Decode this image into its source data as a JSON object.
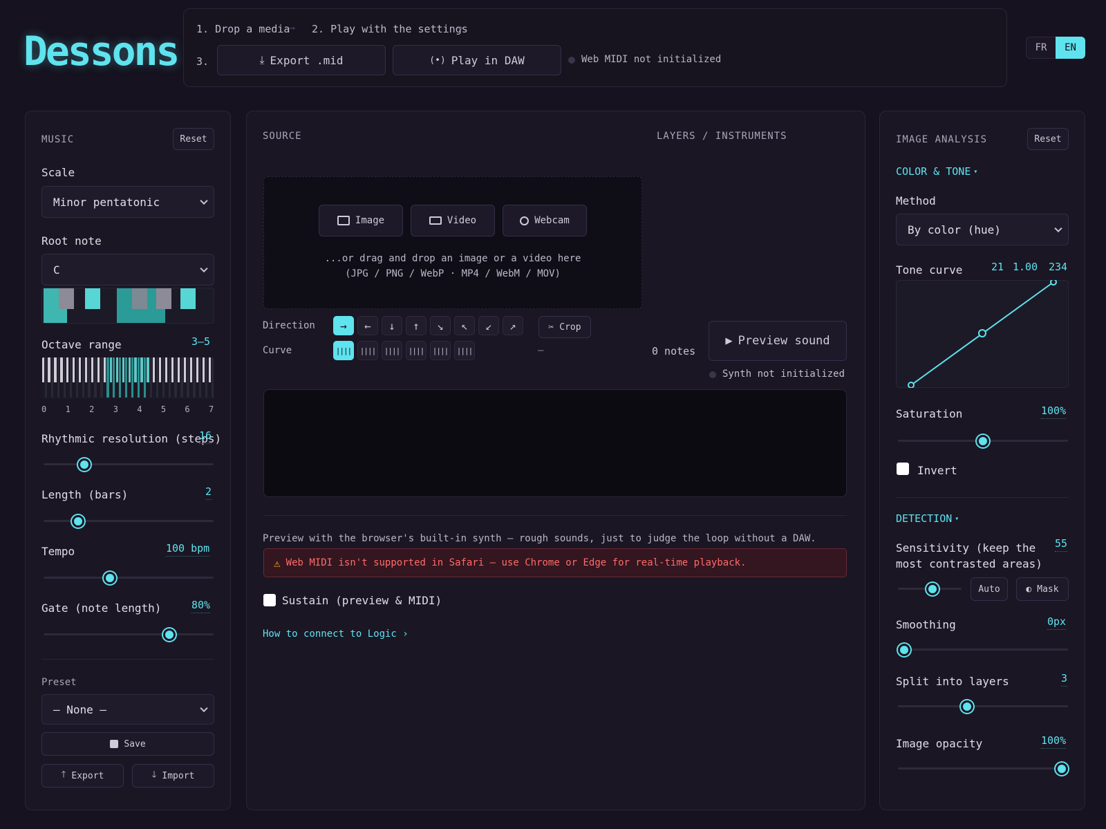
{
  "app": {
    "logo": "Dessons"
  },
  "steps": {
    "step1": "1. Drop a media",
    "step2": "2. Play with the settings",
    "step3": "3.",
    "export_label": "Export .mid",
    "play_daw_label": "Play in DAW",
    "midi_status": "Web MIDI not initialized"
  },
  "lang": {
    "fr": "FR",
    "en": "EN",
    "active": "EN"
  },
  "music": {
    "title": "MUSIC",
    "reset": "Reset",
    "scale_label": "Scale",
    "scale_value": "Minor pentatonic",
    "root_label": "Root note",
    "root_value": "C",
    "octave_label": "Octave range",
    "octave_value": "3–5",
    "octave_ticks": [
      "0",
      "1",
      "2",
      "3",
      "4",
      "5",
      "6",
      "7"
    ],
    "rhythm_label": "Rhythmic resolution (steps)",
    "rhythm_value": "16",
    "length_label": "Length (bars)",
    "length_value": "2",
    "tempo_label": "Tempo",
    "tempo_value": "100 bpm",
    "gate_label": "Gate (note length)",
    "gate_value": "80%",
    "preset_label": "Preset",
    "preset_value": "– None –",
    "save_label": "Save",
    "export_label": "Export",
    "import_label": "Import",
    "slider_levels": {
      "rhythm": 0.22,
      "length": 0.18,
      "tempo": 0.38,
      "gate": 0.76
    }
  },
  "source": {
    "title": "SOURCE",
    "layers_title": "LAYERS / INSTRUMENTS",
    "image_btn": "Image",
    "video_btn": "Video",
    "webcam_btn": "Webcam",
    "drop_line1": "...or drag and drop an image or a video here",
    "drop_line2": "(JPG / PNG / WebP · MP4 / WebM / MOV)",
    "direction_label": "Direction",
    "curve_label": "Curve",
    "crop_label": "Crop",
    "dash": "–",
    "notes_count": "0 notes",
    "preview_label": "Preview sound",
    "synth_status": "Synth not initialized",
    "preview_note": "Preview with the browser's built-in synth — rough sounds, just to judge the loop without a DAW.",
    "warning": "Web MIDI isn't supported in Safari — use Chrome or Edge for real-time playback.",
    "sustain_label": "Sustain (preview & MIDI)",
    "logic_link": "How to connect to Logic ›"
  },
  "analysis": {
    "title": "IMAGE ANALYSIS",
    "reset": "Reset",
    "color_section": "COLOR & TONE",
    "method_label": "Method",
    "method_value": "By color (hue)",
    "tone_label": "Tone curve",
    "tone_low": "21",
    "tone_gamma": "1.00",
    "tone_high": "234",
    "saturation_label": "Saturation",
    "saturation_value": "100%",
    "invert_label": "Invert",
    "detection_section": "DETECTION",
    "sensitivity_label": "Sensitivity (keep the most contrasted areas)",
    "sensitivity_value": "55",
    "auto_label": "Auto",
    "mask_label": "Mask",
    "smoothing_label": "Smoothing",
    "smoothing_value": "0px",
    "split_label": "Split into layers",
    "split_value": "3",
    "opacity_label": "Image opacity",
    "opacity_value": "100%",
    "slider_levels": {
      "saturation": 0.5,
      "sensitivity": 0.55,
      "smoothing": 0.0,
      "split": 0.4,
      "opacity": 1.0
    }
  },
  "colors": {
    "accent": "#5fe3ee",
    "background": "#16121f",
    "panel": "#1a1624",
    "warning_bg": "#3a1a22",
    "warning_text": "#ff6b6b"
  }
}
